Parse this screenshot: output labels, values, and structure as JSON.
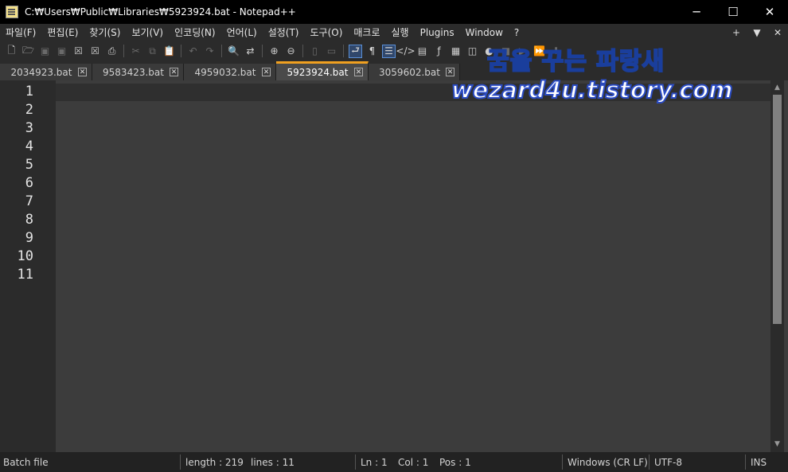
{
  "window": {
    "title": "C:₩Users₩Public₩Libraries₩5923924.bat - Notepad++",
    "minimize": "─",
    "maximize": "☐",
    "close": "✕"
  },
  "menu": {
    "items": [
      "파일(F)",
      "편집(E)",
      "찾기(S)",
      "보기(V)",
      "인코딩(N)",
      "언어(L)",
      "설정(T)",
      "도구(O)",
      "매크로",
      "실행",
      "Plugins",
      "Window",
      "?"
    ],
    "right": [
      "+",
      "▼",
      "✕"
    ]
  },
  "toolbar": {
    "icons": [
      "new-file-icon",
      "open-file-icon",
      "save-icon",
      "save-all-icon",
      "close-icon",
      "close-all-icon",
      "print-icon",
      "cut-icon",
      "copy-icon",
      "paste-icon",
      "undo-icon",
      "redo-icon",
      "find-icon",
      "replace-icon",
      "zoom-in-icon",
      "zoom-out-icon",
      "sync-v-icon",
      "sync-h-icon",
      "word-wrap-icon",
      "show-all-chars-icon",
      "indent-guide-icon",
      "lang-icon",
      "doc-map-icon",
      "func-list-icon",
      "folder-icon",
      "monitor-icon",
      "record-icon",
      "stop-icon",
      "play-icon",
      "play-multi-icon",
      "save-macro-icon"
    ]
  },
  "tabs": [
    {
      "label": "2034923.bat",
      "active": false
    },
    {
      "label": "9583423.bat",
      "active": false
    },
    {
      "label": "4959032.bat",
      "active": false
    },
    {
      "label": "5923924.bat",
      "active": true
    },
    {
      "label": "3059602.bat",
      "active": false
    }
  ],
  "editor": {
    "line_numbers": [
      "1",
      "2",
      "3",
      "4",
      "5",
      "6",
      "7",
      "8",
      "9",
      "10",
      "11"
    ]
  },
  "watermark": {
    "korean": "꿈을 꾸는 파랑새",
    "url": "wezard4u.tistory.com"
  },
  "status": {
    "file_type": "Batch file",
    "length": "length : 219",
    "lines": "lines : 11",
    "ln": "Ln : 1",
    "col": "Col : 1",
    "pos": "Pos : 1",
    "eol": "Windows (CR LF)",
    "encoding": "UTF-8",
    "mode": "INS"
  }
}
